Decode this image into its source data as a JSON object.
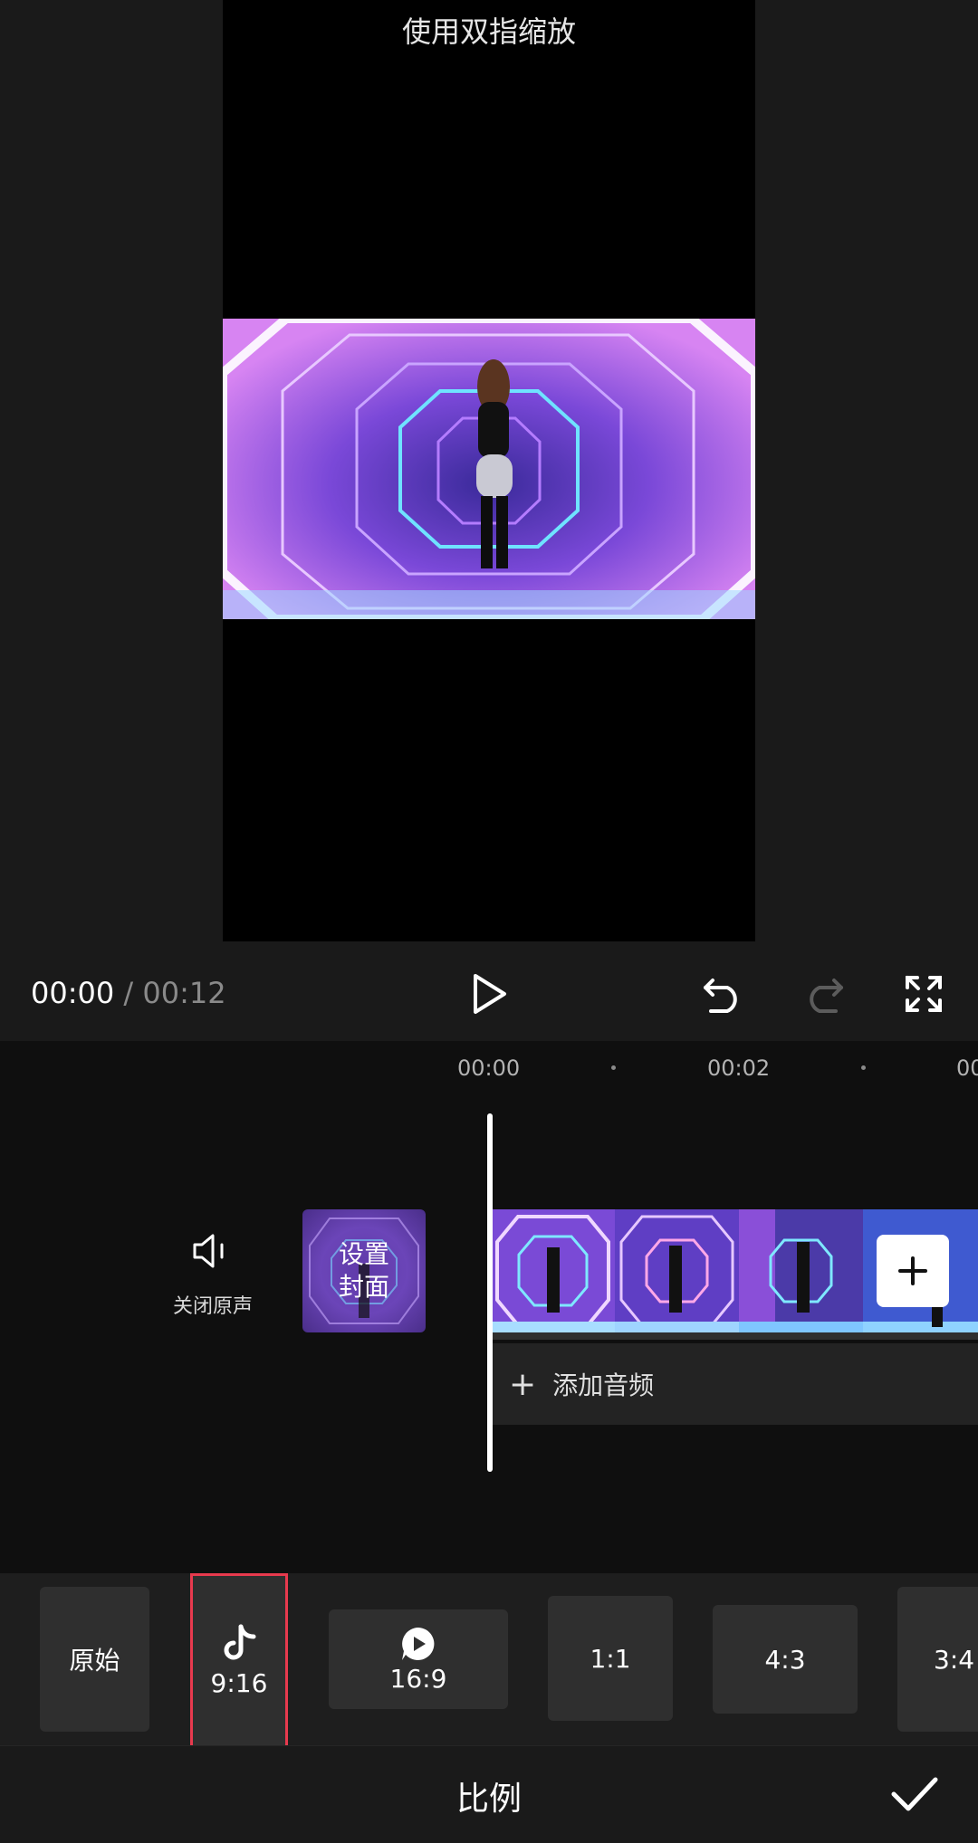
{
  "preview": {
    "hint": "使用双指缩放"
  },
  "playback": {
    "current_time": "00:00",
    "separator": "/",
    "total_time": "00:12"
  },
  "timeline": {
    "ticks": [
      "00:00",
      "00:02",
      "00"
    ],
    "mute_label": "关闭原声",
    "cover_line1": "设置",
    "cover_line2": "封面",
    "add_audio_label": "添加音频",
    "add_audio_plus": "+",
    "add_clip_plus": "+"
  },
  "ratios": [
    {
      "label": "原始",
      "icon": null,
      "selected": false
    },
    {
      "label": "9:16",
      "icon": "tiktok-icon",
      "selected": true
    },
    {
      "label": "16:9",
      "icon": "play-bubble-icon",
      "selected": false
    },
    {
      "label": "1:1",
      "icon": null,
      "selected": false
    },
    {
      "label": "4:3",
      "icon": null,
      "selected": false
    },
    {
      "label": "3:4",
      "icon": null,
      "selected": false
    }
  ],
  "bottom": {
    "title": "比例"
  },
  "colors": {
    "selected_border": "#e83a4e",
    "tile_bg": "#2f2f2f"
  }
}
